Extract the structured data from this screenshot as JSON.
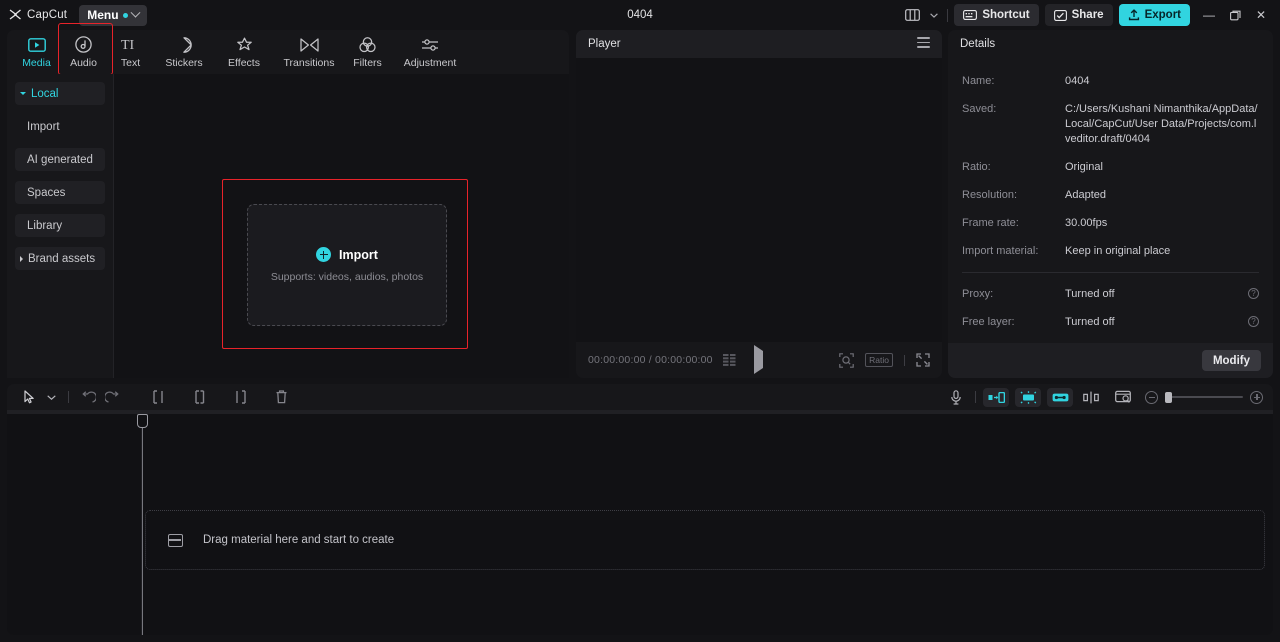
{
  "titlebar": {
    "brand": "CapCut",
    "menu_label": "Menu",
    "project_title": "0404",
    "layout_icon": "panel-layout-icon",
    "shortcut_label": "Shortcut",
    "share_label": "Share",
    "export_label": "Export",
    "minimize": "—",
    "maximize": "❐",
    "close": "✕",
    "accent_color": "#31d4e0",
    "highlight_color": "#e8232a"
  },
  "media_panel": {
    "tabs": [
      {
        "label": "Media",
        "icon": "media-video-icon",
        "active": true
      },
      {
        "label": "Audio",
        "icon": "audio-note-icon",
        "active": false
      },
      {
        "label": "Text",
        "icon": "text-ti-icon",
        "active": false
      },
      {
        "label": "Stickers",
        "icon": "sticker-icon",
        "active": false
      },
      {
        "label": "Effects",
        "icon": "effects-sparkle-icon",
        "active": false
      },
      {
        "label": "Transitions",
        "icon": "transitions-bowtie-icon",
        "active": false
      },
      {
        "label": "Filters",
        "icon": "filters-circles-icon",
        "active": false
      },
      {
        "label": "Adjustment",
        "icon": "adjustment-sliders-icon",
        "active": false
      }
    ],
    "sidebar": [
      {
        "label": "Local",
        "active": true,
        "caret": "down"
      },
      {
        "label": "Import",
        "active": false,
        "caret": "none"
      },
      {
        "label": "AI generated",
        "active": false,
        "caret": "none"
      },
      {
        "label": "Spaces",
        "active": false,
        "caret": "none"
      },
      {
        "label": "Library",
        "active": false,
        "caret": "none"
      },
      {
        "label": "Brand assets",
        "active": false,
        "caret": "right"
      }
    ],
    "import": {
      "label": "Import",
      "sub": "Supports: videos, audios, photos",
      "plus_icon": "plus-circle-icon"
    }
  },
  "player": {
    "title": "Player",
    "menu_icon": "hamburger-icon",
    "current_time": "00:00:00:00",
    "total_time": "00:00:00:00",
    "time_separator": "/",
    "quality_icon": "quality-bars-icon",
    "play_icon": "play-icon",
    "magnifier_icon": "magnifier-icon",
    "ratio_label": "Ratio",
    "fullscreen_icon": "fullscreen-icon"
  },
  "details": {
    "title": "Details",
    "rows": [
      {
        "key": "Name:",
        "value": "0404",
        "help": false
      },
      {
        "key": "Saved:",
        "value": "C:/Users/Kushani Nimanthika/AppData/Local/CapCut/User Data/Projects/com.lveditor.draft/0404",
        "help": false
      },
      {
        "key": "Ratio:",
        "value": "Original",
        "help": false
      },
      {
        "key": "Resolution:",
        "value": "Adapted",
        "help": false
      },
      {
        "key": "Frame rate:",
        "value": "30.00fps",
        "help": false
      },
      {
        "key": "Import material:",
        "value": "Keep in original place",
        "help": false
      }
    ],
    "rows_after_divider": [
      {
        "key": "Proxy:",
        "value": "Turned off",
        "help": true
      },
      {
        "key": "Free layer:",
        "value": "Turned off",
        "help": true
      }
    ],
    "help_glyph": "?",
    "modify_label": "Modify"
  },
  "timeline": {
    "left_tools": [
      {
        "icon": "cursor-select-icon"
      },
      {
        "icon": "chevron-down-icon"
      },
      {
        "icon": "undo-icon"
      },
      {
        "icon": "redo-icon"
      },
      {
        "icon": "split-left-icon"
      },
      {
        "icon": "split-icon"
      },
      {
        "icon": "split-right-icon"
      },
      {
        "icon": "delete-trash-icon"
      }
    ],
    "right_tools": [
      {
        "icon": "microphone-icon",
        "highlight": false
      },
      {
        "icon": "clip-in-icon",
        "highlight": true
      },
      {
        "icon": "auto-cut-icon",
        "highlight": true
      },
      {
        "icon": "clip-out-icon",
        "highlight": true
      },
      {
        "icon": "split-marker-icon",
        "highlight": false
      },
      {
        "icon": "preview-frame-icon",
        "highlight": false
      }
    ],
    "zoom_out_icon": "zoom-out-icon",
    "zoom_in_icon": "zoom-in-icon",
    "dropzone_text": "Drag material here and start to create",
    "dropzone_icon": "material-card-icon"
  }
}
